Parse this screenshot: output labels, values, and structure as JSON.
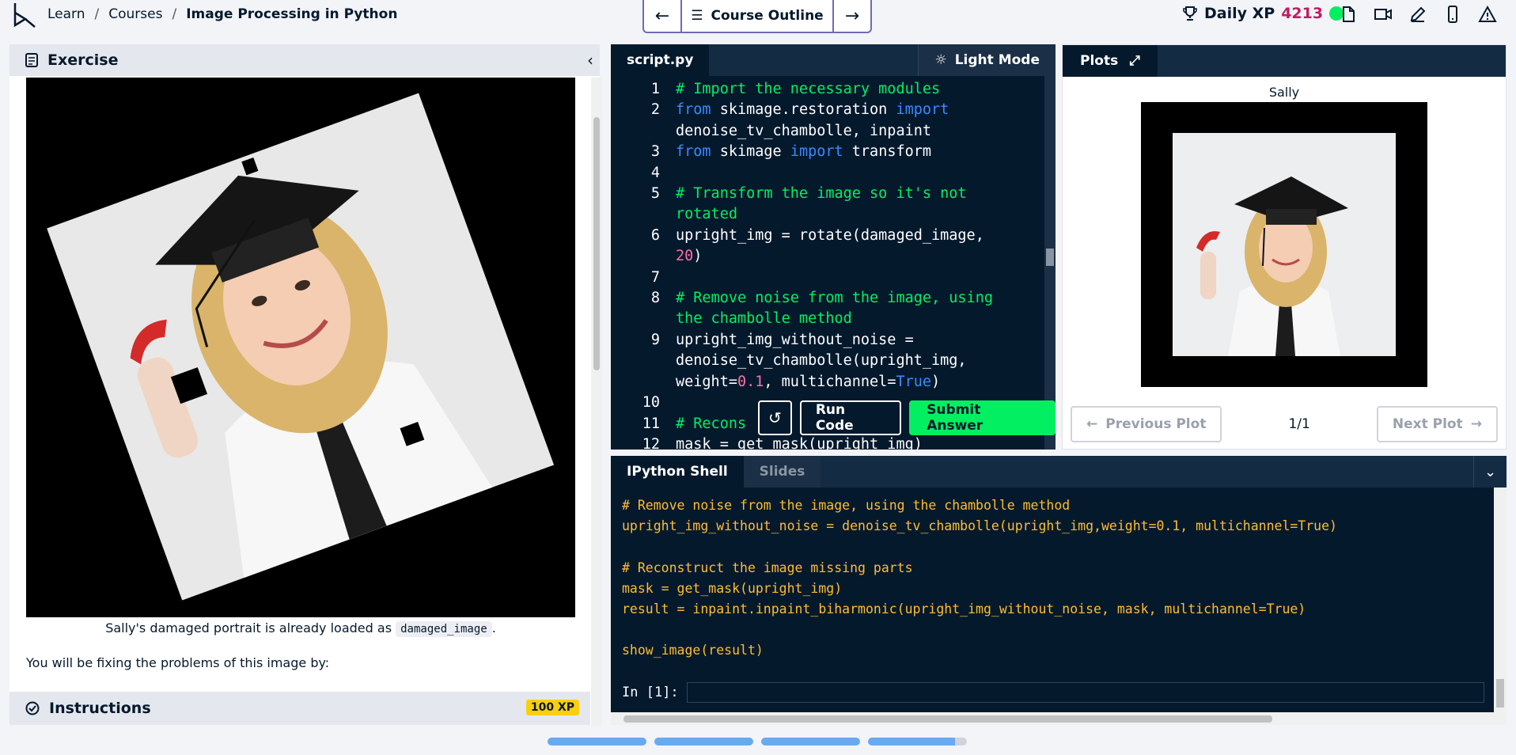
{
  "header": {
    "breadcrumb": [
      "Learn",
      "Courses",
      "Image Processing in Python"
    ],
    "separator": "/",
    "course_outline": "Course Outline",
    "xp_label": "Daily XP",
    "xp_value": "4213"
  },
  "exercise": {
    "title": "Exercise",
    "caption_text": "Sally's damaged portrait is already loaded as",
    "caption_code": "damaged_image",
    "caption_end": ".",
    "paragraph": "You will be fixing the problems of this image by:",
    "instructions_title": "Instructions",
    "xp_badge": "100 XP"
  },
  "editor": {
    "tab": "script.py",
    "light_mode": "Light Mode",
    "lines": [
      {
        "num": "1",
        "parts": [
          {
            "t": "# Import the necessary modules",
            "c": "c"
          }
        ]
      },
      {
        "num": "2",
        "parts": [
          {
            "t": "from",
            "c": "k"
          },
          {
            "t": " skimage.restoration "
          },
          {
            "t": "import",
            "c": "k"
          }
        ]
      },
      {
        "num": "",
        "parts": [
          {
            "t": "denoise_tv_chambolle, inpaint"
          }
        ]
      },
      {
        "num": "3",
        "parts": [
          {
            "t": "from",
            "c": "k"
          },
          {
            "t": " skimage "
          },
          {
            "t": "import",
            "c": "k"
          },
          {
            "t": " transform"
          }
        ]
      },
      {
        "num": "4",
        "parts": [
          {
            "t": ""
          }
        ]
      },
      {
        "num": "5",
        "parts": [
          {
            "t": "# Transform the image so it's not",
            "c": "c"
          }
        ]
      },
      {
        "num": "",
        "parts": [
          {
            "t": "rotated",
            "c": "c"
          }
        ]
      },
      {
        "num": "6",
        "parts": [
          {
            "t": "upright_img = rotate(damaged_image,"
          }
        ]
      },
      {
        "num": "",
        "parts": [
          {
            "t": "20",
            "c": "n"
          },
          {
            "t": ")"
          }
        ]
      },
      {
        "num": "7",
        "parts": [
          {
            "t": ""
          }
        ]
      },
      {
        "num": "8",
        "parts": [
          {
            "t": "# Remove noise from the image, using",
            "c": "c"
          }
        ]
      },
      {
        "num": "",
        "parts": [
          {
            "t": "the chambolle method",
            "c": "c"
          }
        ]
      },
      {
        "num": "9",
        "parts": [
          {
            "t": "upright_img_without_noise ="
          }
        ]
      },
      {
        "num": "",
        "parts": [
          {
            "t": "denoise_tv_chambolle(upright_img,"
          }
        ]
      },
      {
        "num": "",
        "parts": [
          {
            "t": "weight="
          },
          {
            "t": "0.1",
            "c": "n"
          },
          {
            "t": ", multichannel="
          },
          {
            "t": "True",
            "c": "k"
          },
          {
            "t": ")"
          }
        ]
      },
      {
        "num": "10",
        "parts": [
          {
            "t": ""
          }
        ]
      },
      {
        "num": "11",
        "parts": [
          {
            "t": "# Recons",
            "c": "c"
          }
        ]
      },
      {
        "num": "12",
        "parts": [
          {
            "t": "mask = get_mask(upright_img)"
          }
        ]
      }
    ],
    "run_code": "Run Code",
    "submit": "Submit Answer"
  },
  "plots": {
    "tab": "Plots",
    "plot_title": "Sally",
    "previous": "Previous Plot",
    "next": "Next Plot",
    "page": "1/1"
  },
  "shell": {
    "tab_active": "IPython Shell",
    "tab_inactive": "Slides",
    "output": [
      "# Remove noise from the image, using the chambolle method",
      "upright_img_without_noise = denoise_tv_chambolle(upright_img,weight=0.1, multichannel=True)",
      "",
      "# Reconstruct the image missing parts",
      "mask = get_mask(upright_img)",
      "result = inpaint.inpaint_biharmonic(upright_img_without_noise, mask, multichannel=True)",
      "",
      "show_image(result)"
    ],
    "prompt": "In [1]:"
  },
  "progress": [
    1.0,
    1.0,
    1.0,
    0.88
  ],
  "colors": {
    "accent_green": "#03ef62",
    "navy": "#05192d",
    "xp_pink": "#c01c62",
    "badge_yellow": "#fcce0d"
  }
}
